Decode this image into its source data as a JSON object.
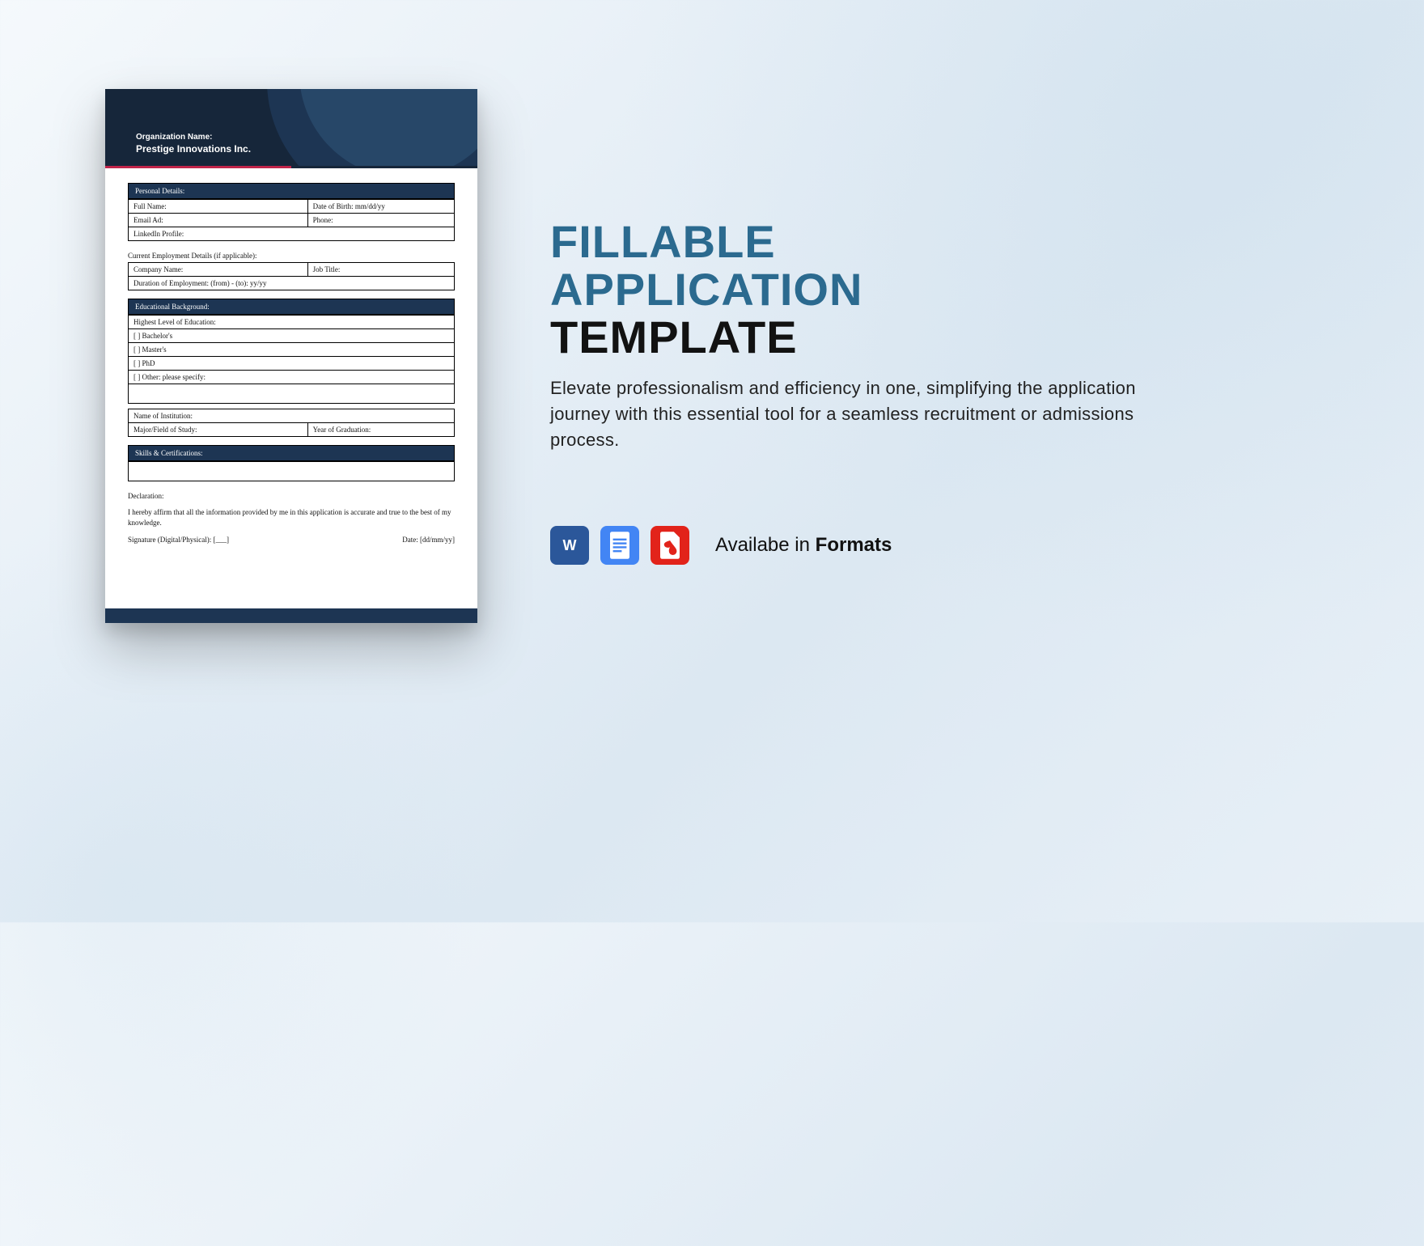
{
  "doc": {
    "org_label": "Organization Name:",
    "org_name": "Prestige Innovations Inc.",
    "sections": {
      "personal": {
        "header": "Personal Details:",
        "full_name": "Full Name:",
        "dob": "Date of Birth:  mm/dd/yy",
        "email": "Email Ad:",
        "phone": "Phone:",
        "linkedin": "LinkedIn Profile:"
      },
      "employment": {
        "intro": "Current Employment Details (if applicable):",
        "company": "Company Name:",
        "job_title": "Job Title:",
        "duration": "Duration of Employment: (from) - (to): yy/yy"
      },
      "education": {
        "header": "Educational Background:",
        "highest": "Highest Level of Education:",
        "opt_bach": "[  ] Bachelor's",
        "opt_mast": "[  ] Master's",
        "opt_phd": "[  ] PhD",
        "opt_other": "[  ] Other: please specify:",
        "institution": "Name of Institution:",
        "major": "Major/Field of Study:",
        "grad": "Year of Graduation:"
      },
      "skills": {
        "header": "Skills & Certifications:"
      },
      "declaration": {
        "label": "Declaration:",
        "text": "I hereby affirm that all the information provided by me in this application is accurate and true to the best of my knowledge.",
        "signature": "Signature (Digital/Physical):   [___]",
        "date": "Date: [dd/mm/yy]"
      }
    }
  },
  "promo": {
    "title_line1": "FILLABLE",
    "title_line2": "APPLICATION",
    "title_line3": "TEMPLATE",
    "description": "Elevate professionalism and efficiency in one, simplifying the application journey with this essential tool for a seamless recruitment or admissions process.",
    "formats_prefix": "Availabe in ",
    "formats_bold": "Formats",
    "icons": {
      "word": "W",
      "docs": "docs-icon",
      "pdf": "pdf-icon"
    }
  }
}
